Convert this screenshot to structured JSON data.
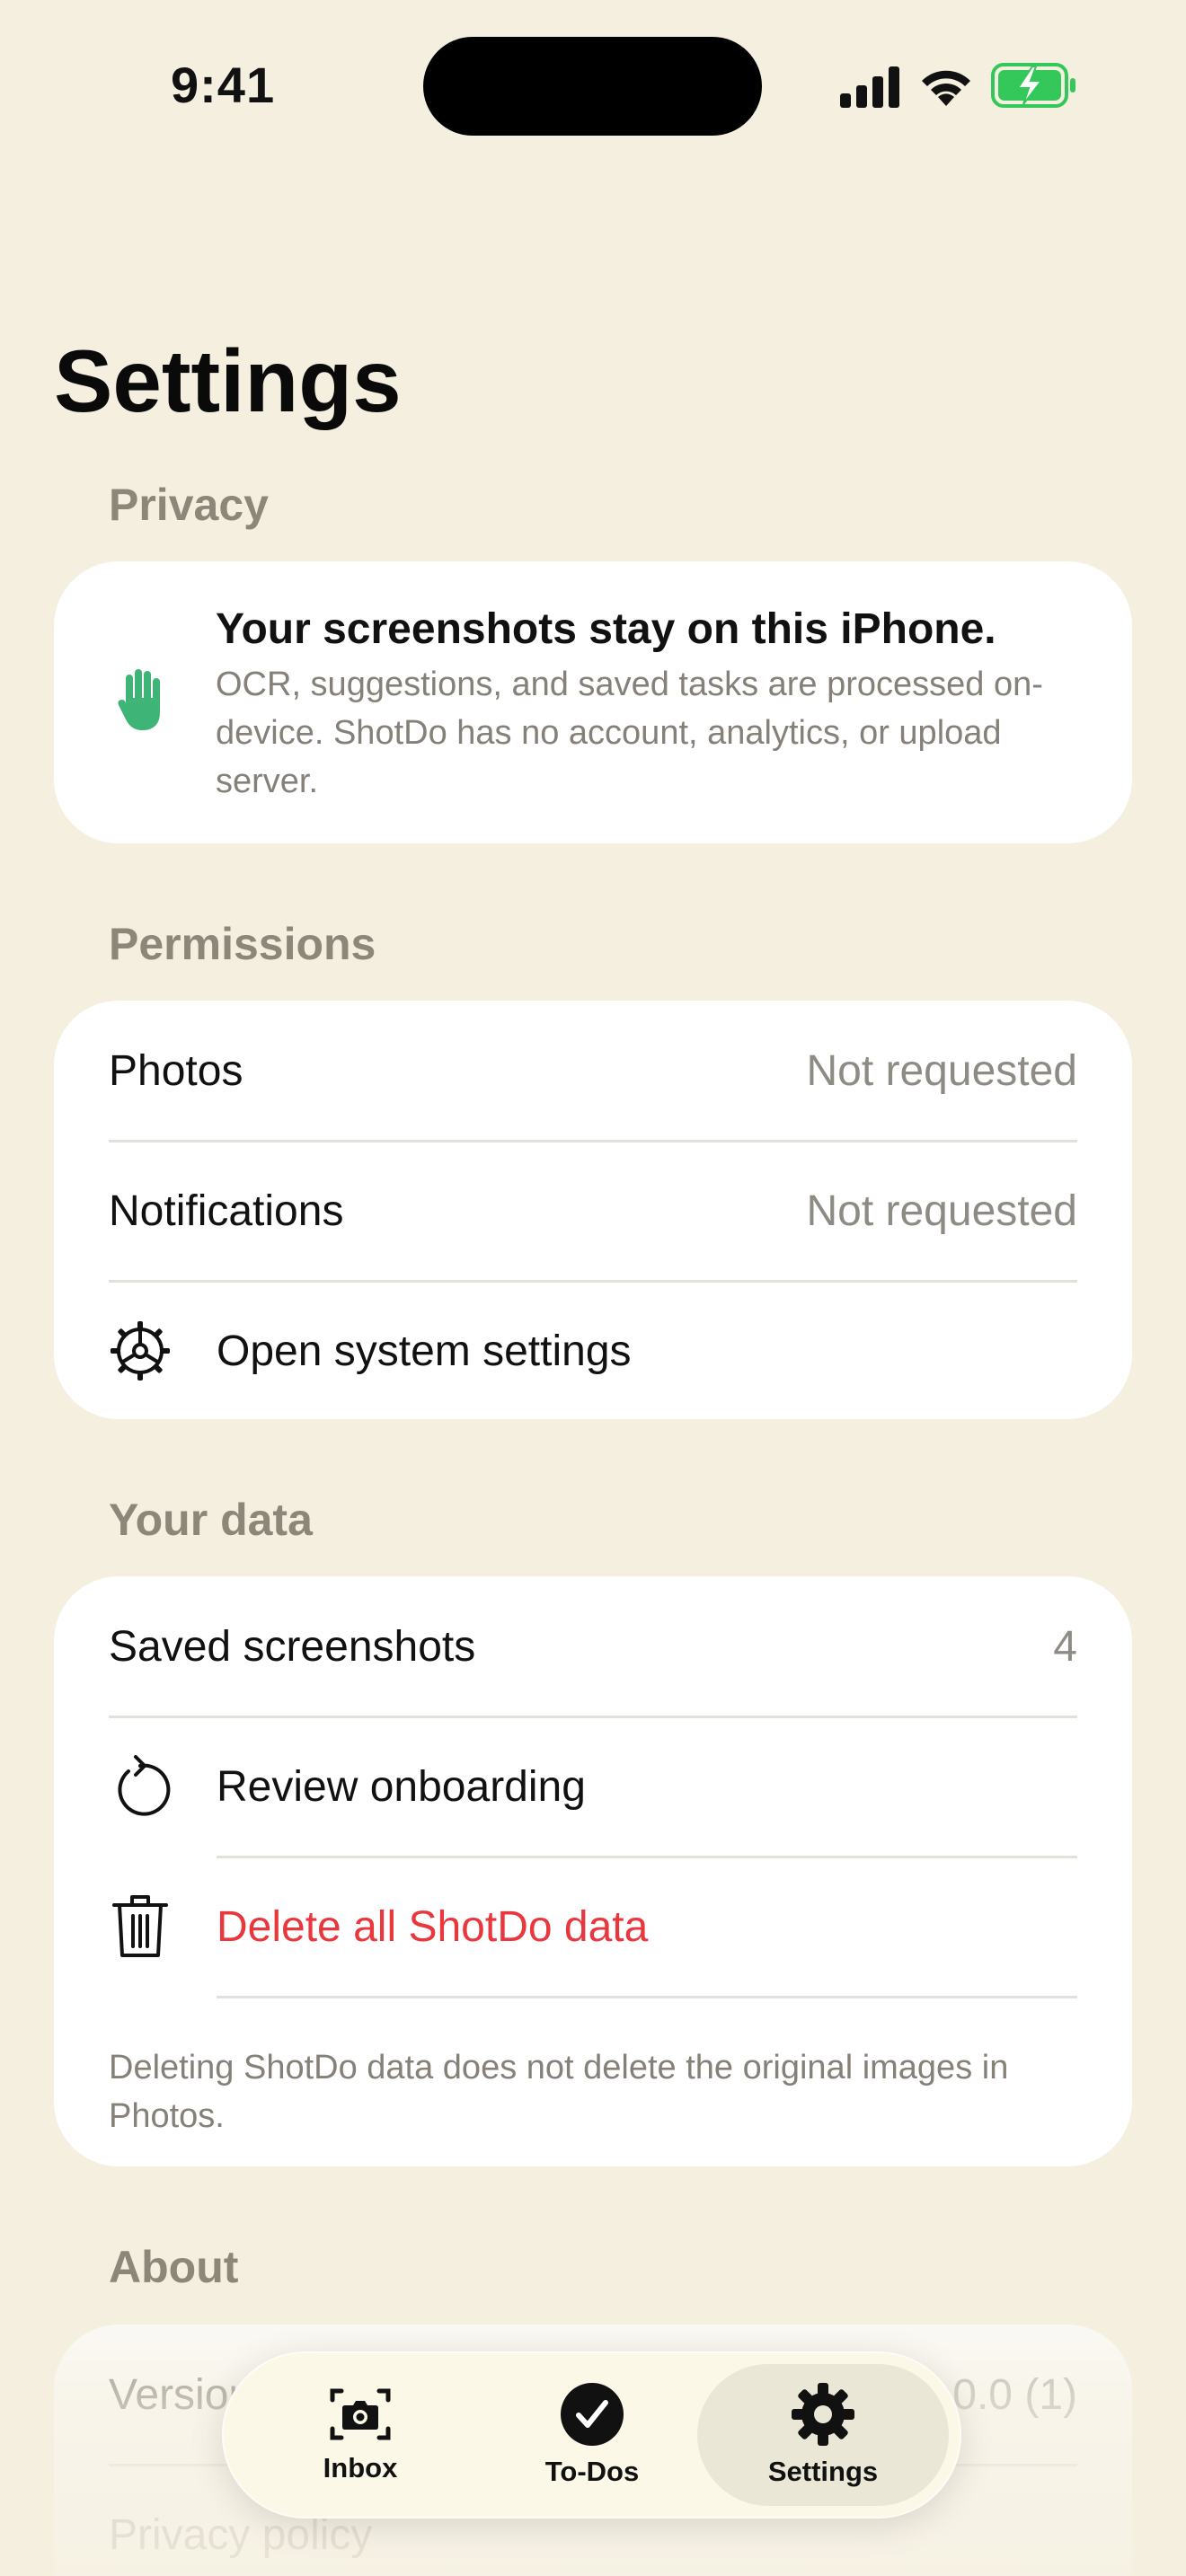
{
  "status_bar": {
    "time": "9:41"
  },
  "page": {
    "title": "Settings"
  },
  "privacy": {
    "header": "Privacy",
    "title": "Your screenshots stay on this iPhone.",
    "body": "OCR, suggestions, and saved tasks are processed on-device. ShotDo has no account, analytics, or upload server."
  },
  "permissions": {
    "header": "Permissions",
    "rows": [
      {
        "label": "Photos",
        "value": "Not requested"
      },
      {
        "label": "Notifications",
        "value": "Not requested"
      }
    ],
    "open_settings_label": "Open system settings"
  },
  "your_data": {
    "header": "Your data",
    "saved_label": "Saved screenshots",
    "saved_count": "4",
    "review_label": "Review onboarding",
    "delete_label": "Delete all ShotDo data",
    "footnote": "Deleting ShotDo data does not delete the original images in Photos."
  },
  "about": {
    "header": "About",
    "version_label": "Version",
    "version_value": "1.0.0 (1)",
    "privacy_policy_label": "Privacy policy"
  },
  "tab_bar": {
    "tabs": [
      {
        "label": "Inbox",
        "icon": "camera-viewfinder-icon"
      },
      {
        "label": "To-Dos",
        "icon": "checkmark-circle-icon"
      },
      {
        "label": "Settings",
        "icon": "gear-icon",
        "active": true
      }
    ]
  },
  "colors": {
    "background": "#f5efdf",
    "card": "#ffffff",
    "section_header": "#8c8779",
    "secondary_text": "#8e8b84",
    "danger": "#e8383e",
    "privacy_icon": "#3fb477",
    "battery": "#34c759"
  }
}
